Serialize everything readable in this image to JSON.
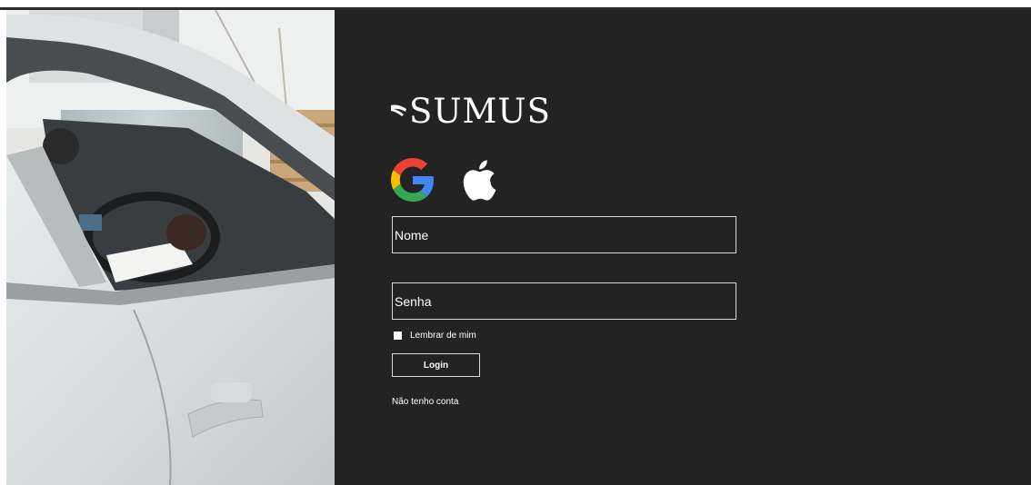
{
  "brand": {
    "name": "SUMUS"
  },
  "hero_image": {
    "alt": "person driving a white car"
  },
  "social": {
    "google_icon": "google-logo-icon",
    "apple_icon": "apple-logo-icon"
  },
  "form": {
    "name_placeholder": "Nome",
    "password_placeholder": "Senha",
    "remember_label": "Lembrar de mim",
    "remember_checked": false,
    "login_label": "Login",
    "no_account_label": "Não tenho conta"
  },
  "colors": {
    "panel_bg": "#232323",
    "text": "#ffffff",
    "border": "#d9d9d9"
  }
}
